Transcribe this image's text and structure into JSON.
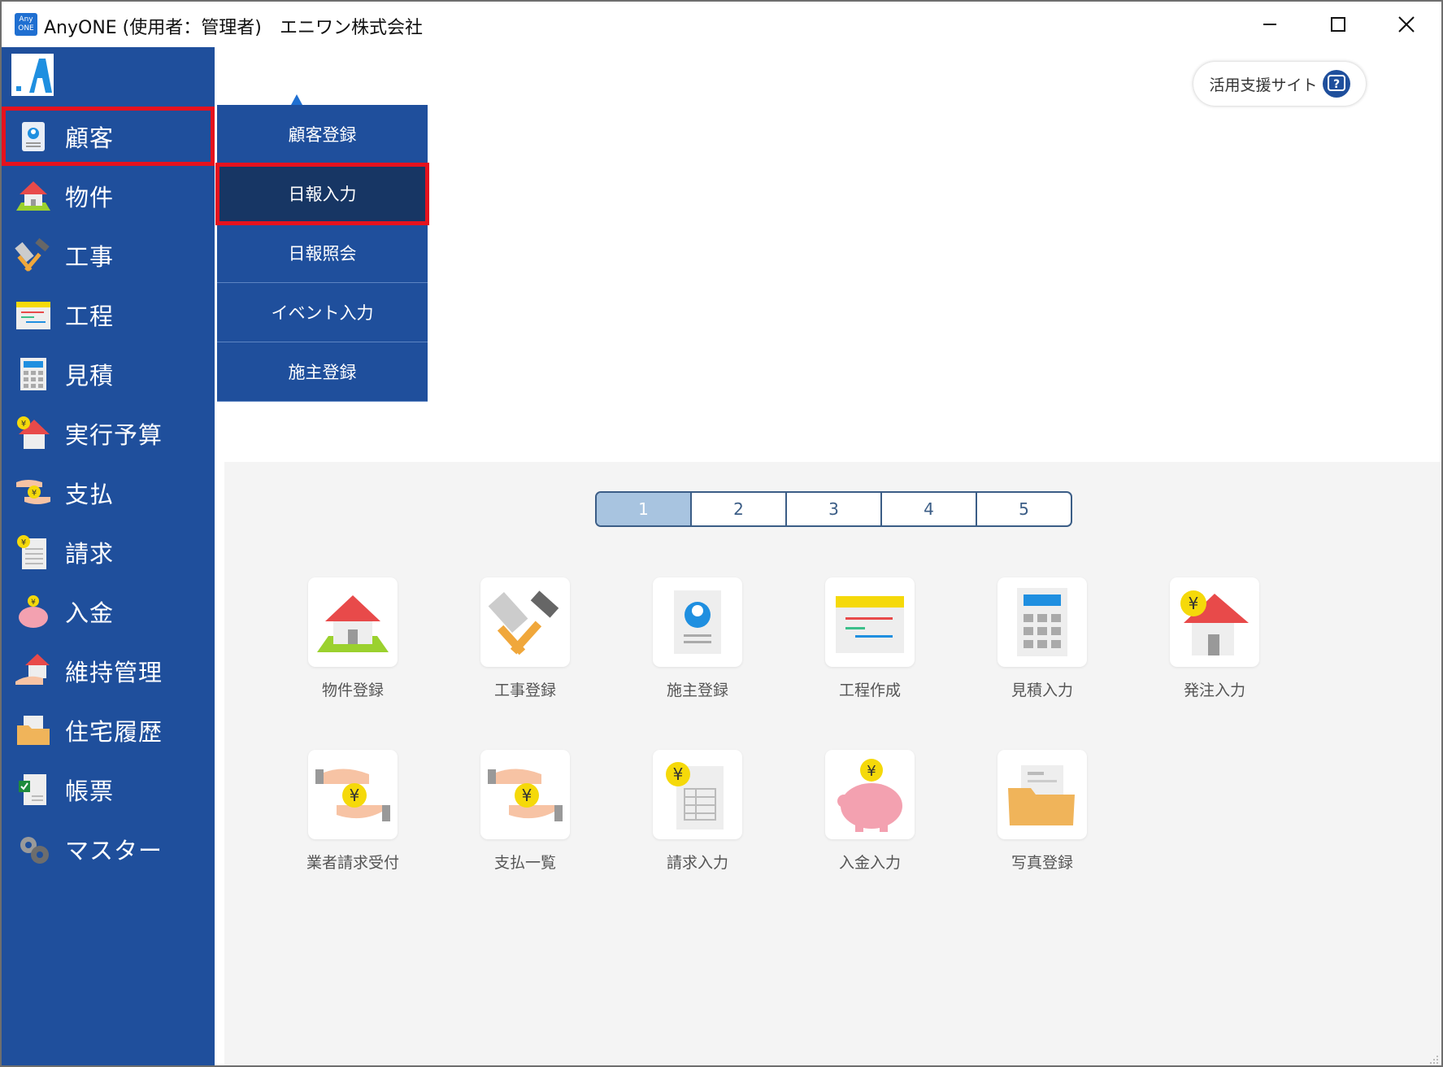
{
  "window": {
    "badge_line1": "Any",
    "badge_line2": "ONE",
    "app_title": "AnyONE (使用者：管理者)",
    "company": "エニワン株式会社"
  },
  "sidebar": {
    "items": [
      {
        "label": "顧客",
        "icon": "customer-icon"
      },
      {
        "label": "物件",
        "icon": "house-icon"
      },
      {
        "label": "工事",
        "icon": "tools-icon"
      },
      {
        "label": "工程",
        "icon": "schedule-icon"
      },
      {
        "label": "見積",
        "icon": "calculator-icon"
      },
      {
        "label": "実行予算",
        "icon": "budget-house-icon"
      },
      {
        "label": "支払",
        "icon": "payment-hands-icon"
      },
      {
        "label": "請求",
        "icon": "invoice-icon"
      },
      {
        "label": "入金",
        "icon": "piggy-bank-icon"
      },
      {
        "label": "維持管理",
        "icon": "maintenance-icon"
      },
      {
        "label": "住宅履歴",
        "icon": "folder-icon"
      },
      {
        "label": "帳票",
        "icon": "report-icon"
      },
      {
        "label": "マスター",
        "icon": "gear-icon"
      }
    ],
    "selected_index": 0
  },
  "submenu": {
    "items": [
      "顧客登録",
      "日報入力",
      "日報照会",
      "イベント入力",
      "施主登録"
    ],
    "active_index": 1
  },
  "help": {
    "label": "活用支援サイト",
    "icon_text": "?"
  },
  "pager": {
    "pages": [
      "1",
      "2",
      "3",
      "4",
      "5"
    ],
    "active": "1"
  },
  "tiles": [
    {
      "label": "物件登録",
      "icon": "house-icon"
    },
    {
      "label": "工事登録",
      "icon": "tools-icon"
    },
    {
      "label": "施主登録",
      "icon": "owner-document-icon"
    },
    {
      "label": "工程作成",
      "icon": "schedule-icon"
    },
    {
      "label": "見積入力",
      "icon": "calculator-icon"
    },
    {
      "label": "発注入力",
      "icon": "order-house-icon"
    },
    {
      "label": "業者請求受付",
      "icon": "vendor-invoice-hands-icon"
    },
    {
      "label": "支払一覧",
      "icon": "payment-hands-icon"
    },
    {
      "label": "請求入力",
      "icon": "invoice-icon"
    },
    {
      "label": "入金入力",
      "icon": "piggy-bank-icon"
    },
    {
      "label": "写真登録",
      "icon": "photo-folder-icon"
    }
  ],
  "colors": {
    "sidebar_bg": "#1f4f9c",
    "submenu_active_bg": "#173664",
    "highlight_red": "#e5121e",
    "content_bg": "#f4f4f4",
    "pager_active": "#a8c4e0",
    "yen_coin": "#f5d90a"
  }
}
